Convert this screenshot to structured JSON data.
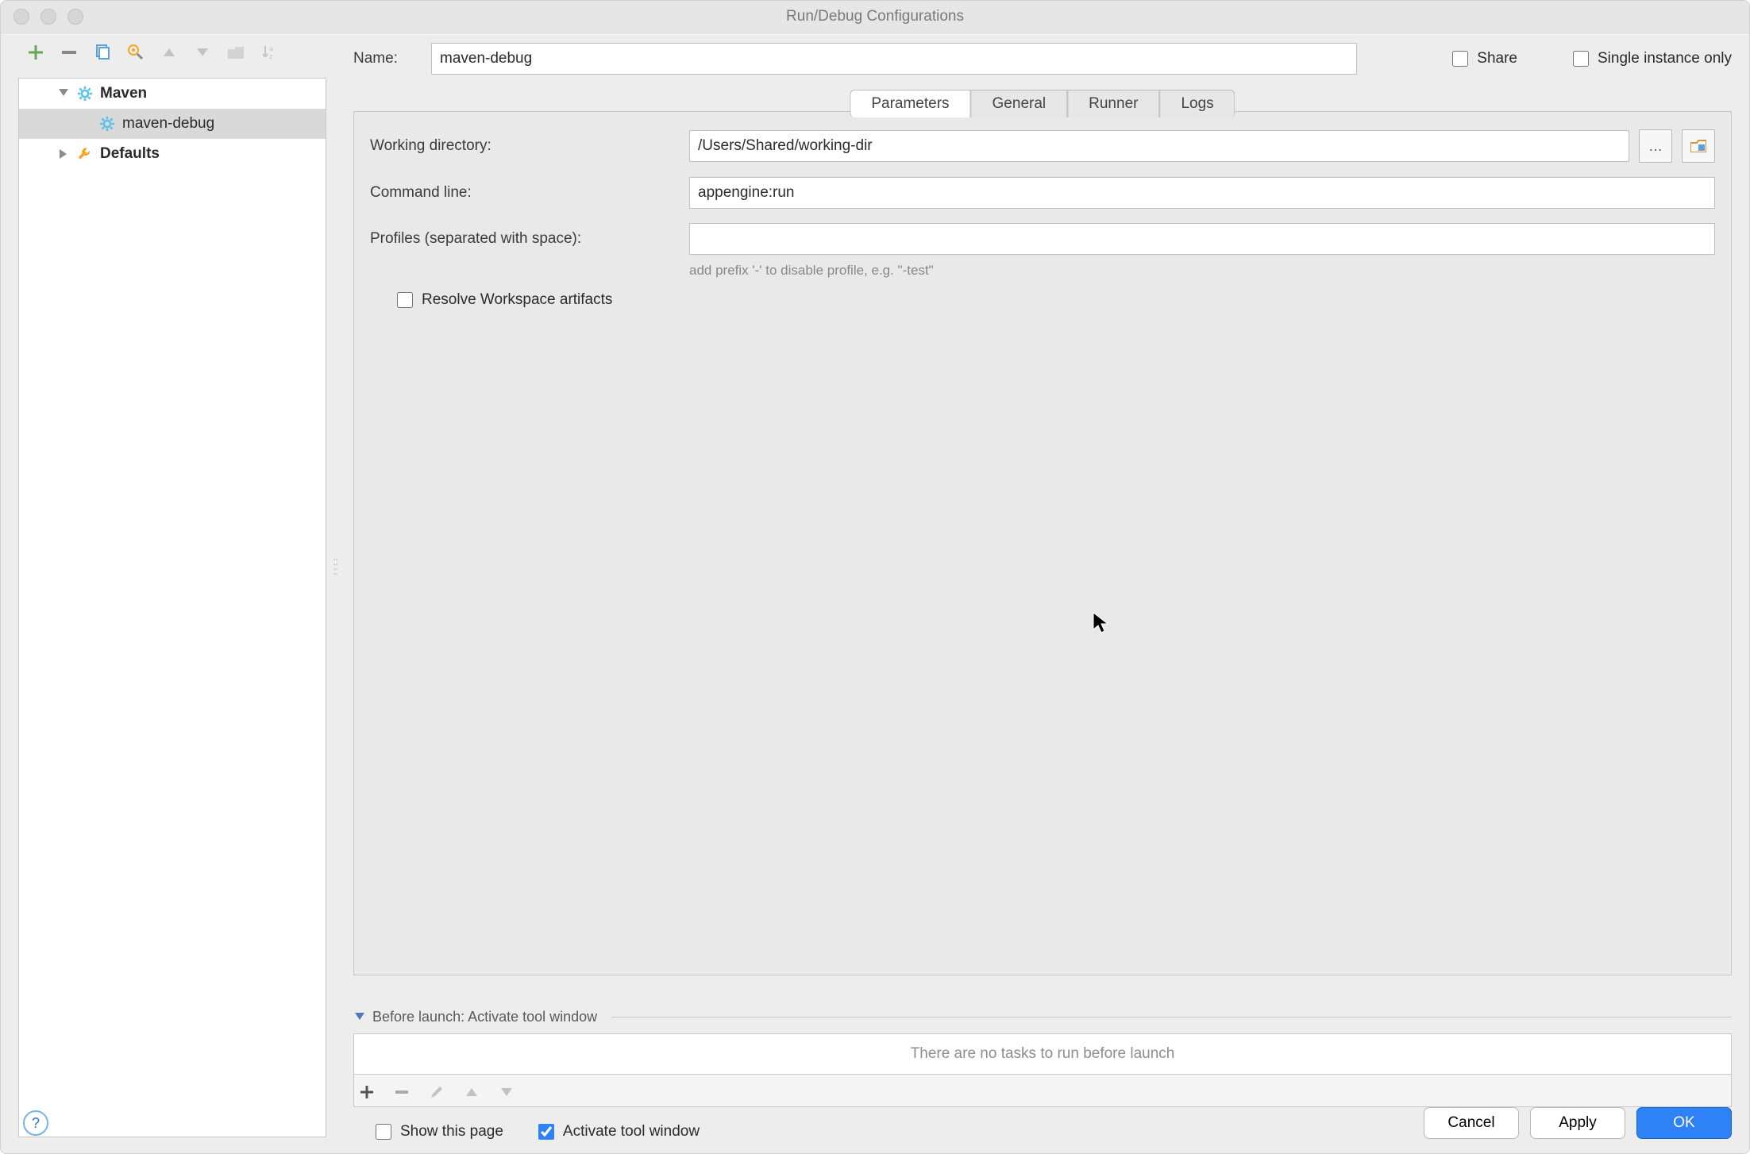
{
  "window": {
    "title": "Run/Debug Configurations"
  },
  "topForm": {
    "nameLabel": "Name:",
    "nameValue": "maven-debug",
    "shareLabel": "Share",
    "shareChecked": false,
    "singleLabel": "Single instance only",
    "singleChecked": false
  },
  "sidebar": {
    "items": [
      {
        "type": "cat",
        "label": "Maven",
        "icon": "gear"
      },
      {
        "type": "cfg",
        "label": "maven-debug",
        "icon": "gear",
        "level": 2,
        "selected": true
      },
      {
        "type": "cat",
        "label": "Defaults",
        "icon": "wrench"
      }
    ]
  },
  "tabs": [
    "Parameters",
    "General",
    "Runner",
    "Logs"
  ],
  "params": {
    "workingDirLabel": "Working directory:",
    "workingDirValue": "/Users/Shared/working-dir",
    "commandLineLabel": "Command line:",
    "commandLineValue": "appengine:run",
    "profilesLabel": "Profiles (separated with space):",
    "profilesValue": "",
    "profilesHint": "add prefix '-' to disable profile, e.g. \"-test\"",
    "resolveLabel": "Resolve Workspace artifacts",
    "resolveChecked": false
  },
  "beforeLaunch": {
    "header": "Before launch: Activate tool window",
    "empty": "There are no tasks to run before launch",
    "showThisPageLabel": "Show this page",
    "showThisPageChecked": false,
    "activateToolLabel": "Activate tool window",
    "activateToolChecked": true
  },
  "buttons": {
    "cancel": "Cancel",
    "apply": "Apply",
    "ok": "OK"
  }
}
